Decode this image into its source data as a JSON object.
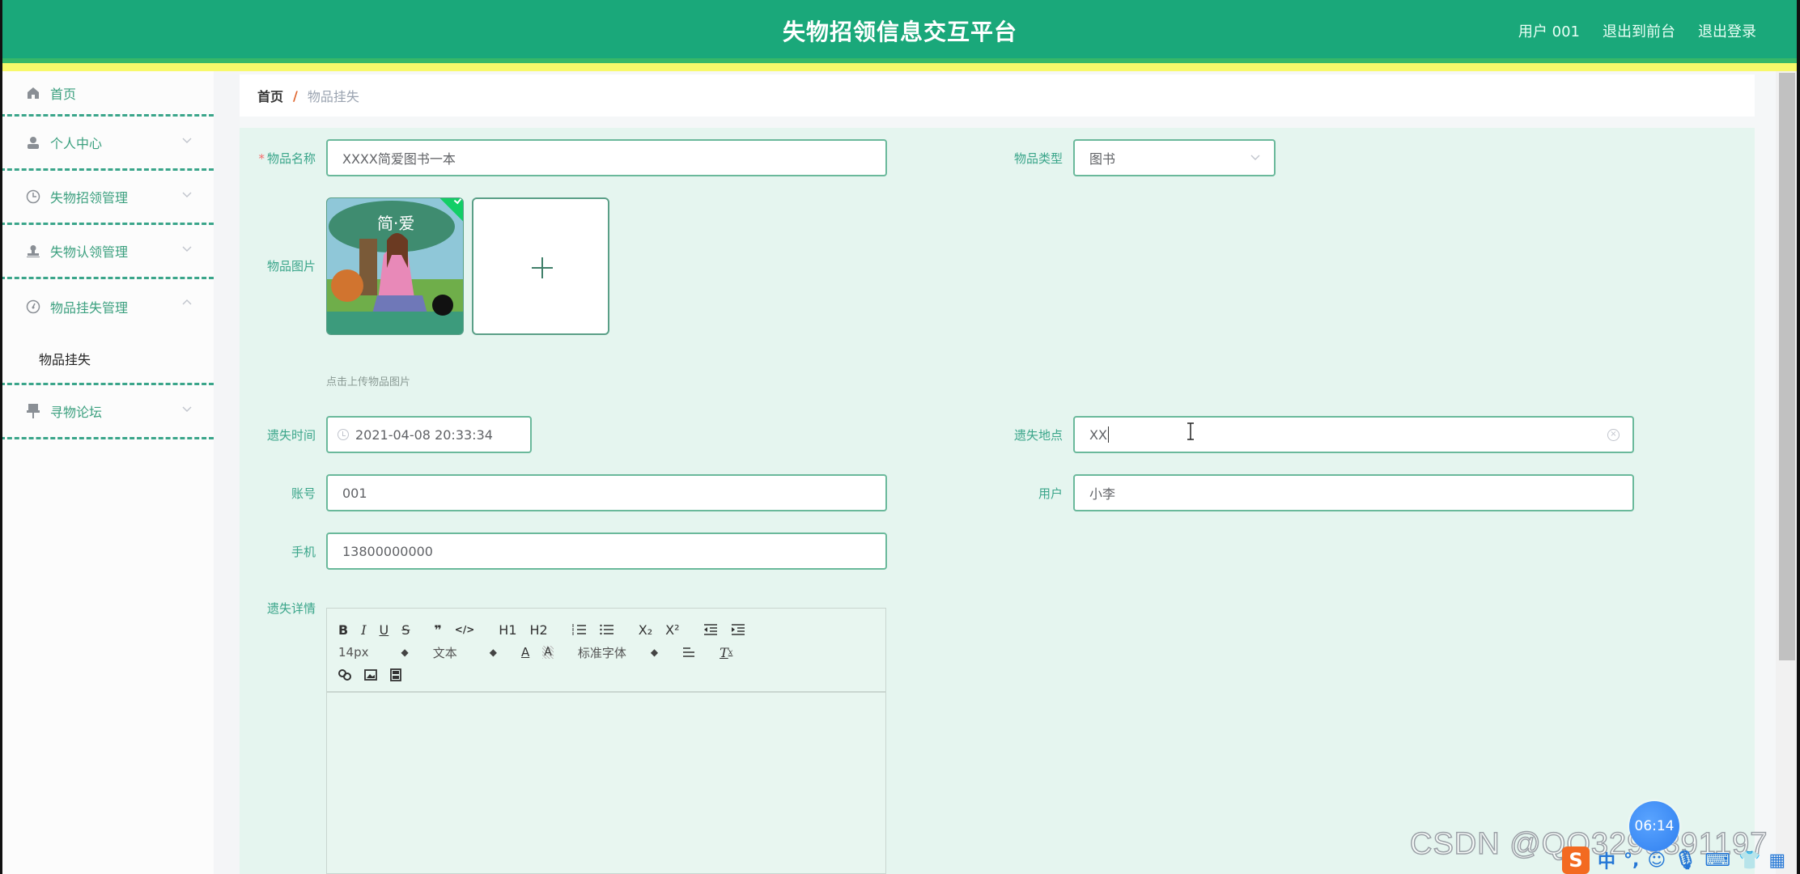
{
  "header": {
    "title": "失物招领信息交互平台",
    "user_label": "用户 001",
    "front_link": "退出到前台",
    "logout_link": "退出登录",
    "colors": {
      "header_bg": "#1aa87a",
      "stripe": "#f8f96a",
      "accent": "#3aa58a"
    }
  },
  "sidebar": {
    "items": [
      {
        "label": "首页",
        "icon": "home-icon",
        "has_chevron": false
      },
      {
        "label": "个人中心",
        "icon": "user-icon",
        "chevron": "down"
      },
      {
        "label": "失物招领管理",
        "icon": "clock-icon",
        "chevron": "down"
      },
      {
        "label": "失物认领管理",
        "icon": "stamp-icon",
        "chevron": "down"
      },
      {
        "label": "物品挂失管理",
        "icon": "gauge-icon",
        "chevron": "up",
        "expanded": true,
        "children": [
          {
            "label": "物品挂失",
            "active": true
          }
        ]
      },
      {
        "label": "寻物论坛",
        "icon": "pin-icon",
        "chevron": "down"
      }
    ]
  },
  "breadcrumb": {
    "home": "首页",
    "separator": "/",
    "current": "物品挂失"
  },
  "form": {
    "item_name": {
      "label": "物品名称",
      "required": true,
      "value": "XXXX简爱图书一本"
    },
    "item_type": {
      "label": "物品类型",
      "value": "图书"
    },
    "item_image": {
      "label": "物品图片",
      "thumbnail_caption": "简·爱",
      "hint": "点击上传物品图片"
    },
    "lost_time": {
      "label": "遗失时间",
      "value": "2021-04-08 20:33:34"
    },
    "lost_place": {
      "label": "遗失地点",
      "value": "XX"
    },
    "account": {
      "label": "账号",
      "value": "001"
    },
    "user": {
      "label": "用户",
      "value": "小李"
    },
    "phone": {
      "label": "手机",
      "value": "13800000000"
    },
    "details": {
      "label": "遗失详情",
      "toolbar": {
        "row1": [
          "B",
          "I",
          "U",
          "S",
          "❞",
          "</>",
          "H1",
          "H2",
          "ordered-list",
          "bullet-list",
          "X₂",
          "X²",
          "outdent",
          "indent"
        ],
        "font_size": "14px",
        "header_select": "文本",
        "font_family": "标准字体",
        "row3": [
          "link",
          "image",
          "video"
        ]
      },
      "content": ""
    }
  },
  "overlays": {
    "timer": "06:14",
    "watermark": "CSDN @QQ3295391197",
    "ime_label": "中"
  }
}
